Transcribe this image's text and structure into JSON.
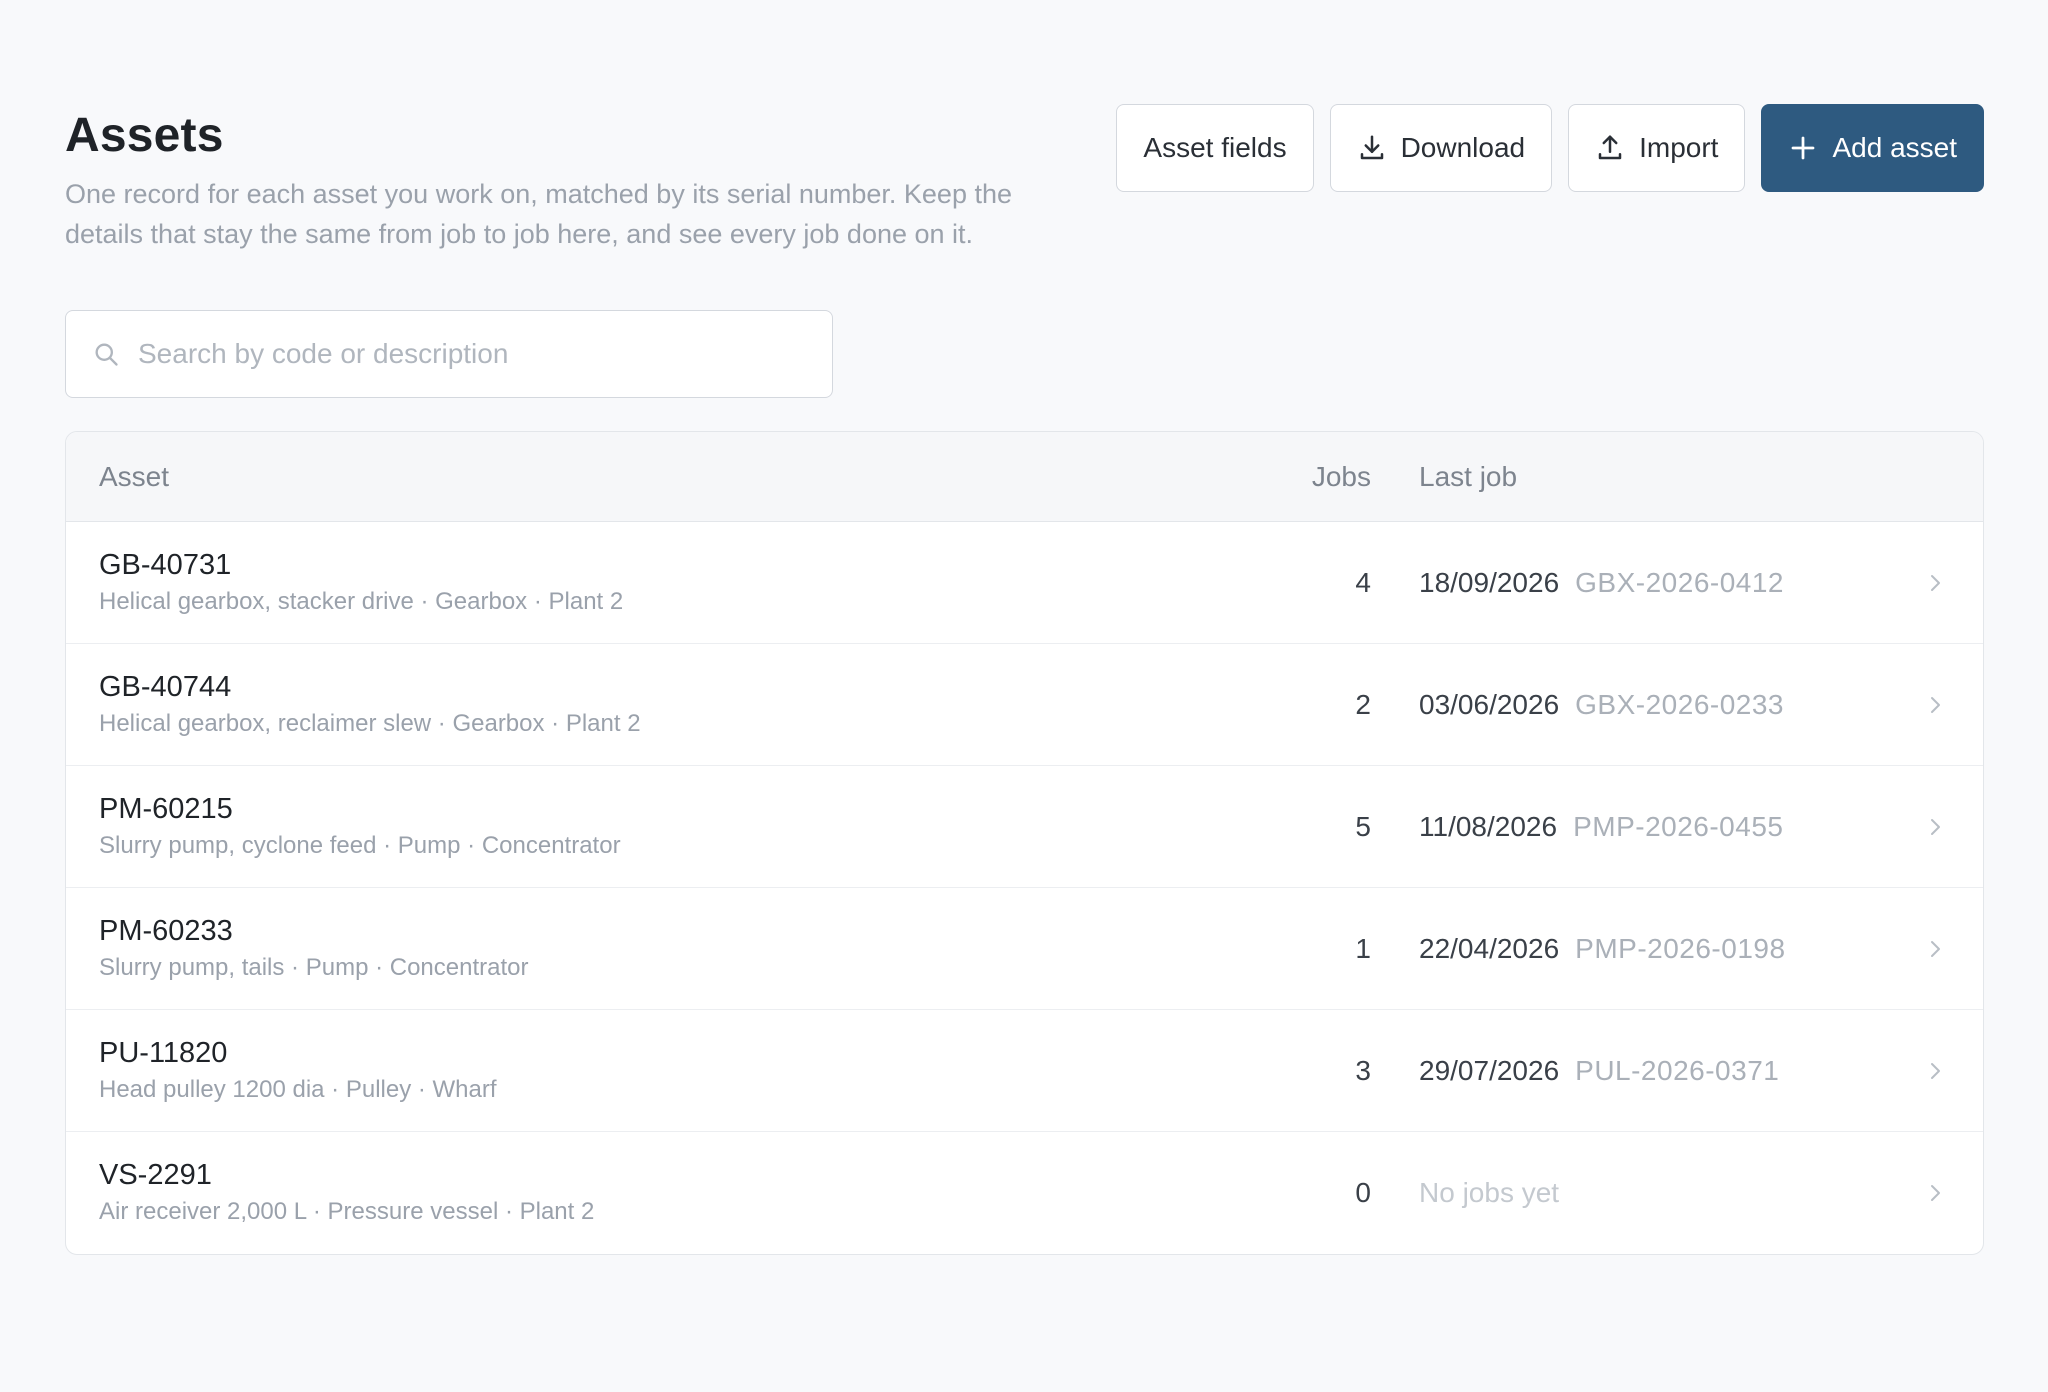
{
  "header": {
    "title": "Assets",
    "subtitle": "One record for each asset you work on, matched by its serial number. Keep the details that stay the same from job to job here, and see every job done on it."
  },
  "actions": {
    "asset_fields": "Asset fields",
    "download": "Download",
    "import": "Import",
    "add_asset": "Add asset"
  },
  "search": {
    "placeholder": "Search by code or description",
    "value": ""
  },
  "table": {
    "columns": {
      "asset": "Asset",
      "jobs": "Jobs",
      "last_job": "Last job"
    },
    "rows": [
      {
        "code": "GB-40731",
        "description": "Helical gearbox, stacker drive · Gearbox · Plant 2",
        "jobs": "4",
        "last_date": "18/09/2026",
        "last_ref": "GBX-2026-0412"
      },
      {
        "code": "GB-40744",
        "description": "Helical gearbox, reclaimer slew · Gearbox · Plant 2",
        "jobs": "2",
        "last_date": "03/06/2026",
        "last_ref": "GBX-2026-0233"
      },
      {
        "code": "PM-60215",
        "description": "Slurry pump, cyclone feed · Pump · Concentrator",
        "jobs": "5",
        "last_date": "11/08/2026",
        "last_ref": "PMP-2026-0455"
      },
      {
        "code": "PM-60233",
        "description": "Slurry pump, tails · Pump · Concentrator",
        "jobs": "1",
        "last_date": "22/04/2026",
        "last_ref": "PMP-2026-0198"
      },
      {
        "code": "PU-11820",
        "description": "Head pulley 1200 dia · Pulley · Wharf",
        "jobs": "3",
        "last_date": "29/07/2026",
        "last_ref": "PUL-2026-0371"
      },
      {
        "code": "VS-2291",
        "description": "Air receiver 2,000 L · Pressure vessel · Plant 2",
        "jobs": "0",
        "no_jobs": "No jobs yet"
      }
    ]
  },
  "colors": {
    "primary": "#2e5a80",
    "background": "#f8f9fb",
    "muted_text": "#9aa1ab"
  }
}
